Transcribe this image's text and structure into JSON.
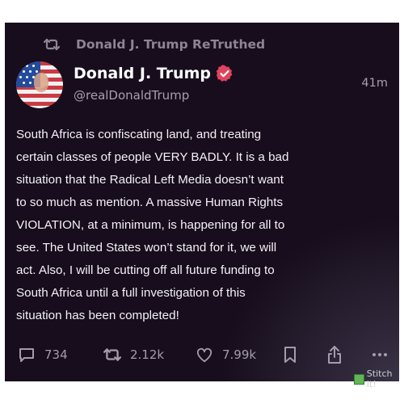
{
  "retruth": {
    "label": "Donald J. Trump ReTruthed"
  },
  "author": {
    "name": "Donald J. Trump",
    "handle": "@realDonaldTrump",
    "timestamp": "41m"
  },
  "post": {
    "lines": [
      "South Africa is confiscating land, and treating",
      "certain classes of people VERY BADLY. It is a bad",
      "situation that the Radical Left Media doesn’t want",
      "to so much as mention. A massive Human Rights",
      "VIOLATION, at a minimum, is happening for all to",
      "see. The United States won’t stand for it, we will",
      "act. Also, I will be cutting off all future funding to",
      "South Africa until a full investigation of this",
      "situation has been completed!"
    ]
  },
  "actions": {
    "replies": "734",
    "retruths": "2.12k",
    "likes": "7.99k"
  },
  "watermark": {
    "label": "Stitch It!"
  },
  "icons": [
    "retruth-icon",
    "verified-badge-icon",
    "reply-icon",
    "retruth-count-icon",
    "like-icon",
    "bookmark-icon",
    "share-icon",
    "more-options-icon"
  ],
  "colors": {
    "background": "#170d1c",
    "verified": "#e0445d",
    "muted": "#8d8595"
  }
}
